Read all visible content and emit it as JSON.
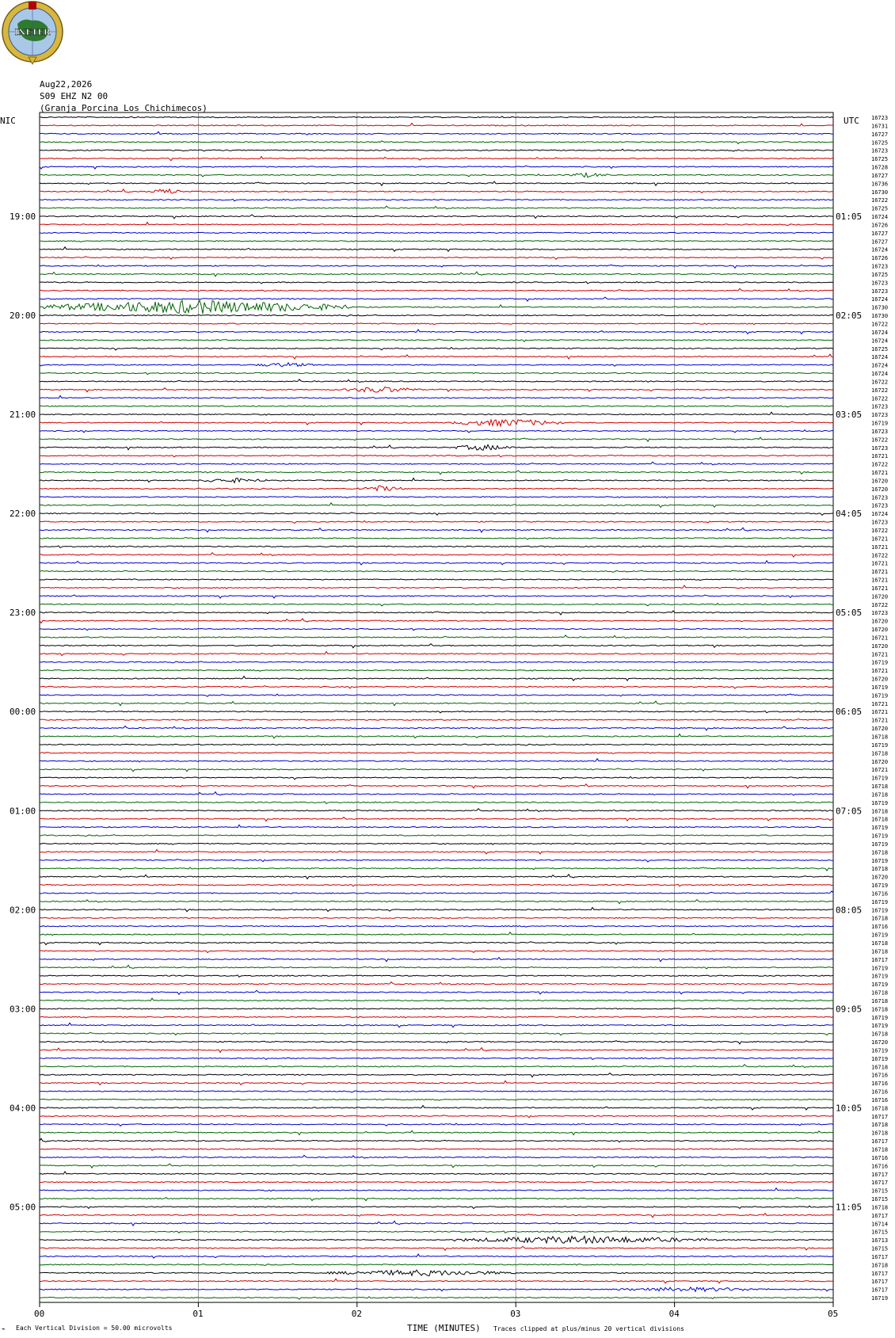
{
  "header": {
    "org": "INETER",
    "date": "Aug22,2026",
    "channel": "S09 EHZ N2 00",
    "station": "(Granja Porcina Los Chichimecos)"
  },
  "labels": {
    "left_tz": "NIC",
    "right_tz": "UTC",
    "xlabel": "TIME (MINUTES)",
    "scale_note": "Each Vertical Division =    50.00 microvolts",
    "clip_note": "Traces clipped at plus/minus 20 vertical divisions"
  },
  "colors": {
    "trace_cycle": [
      "#000000",
      "#d00000",
      "#0000d0",
      "#006400"
    ],
    "grid": "#888888"
  },
  "chart_data": {
    "type": "line",
    "title": "",
    "xlabel": "TIME (MINUTES)",
    "ylabel": "",
    "xlim": [
      0,
      5
    ],
    "x_ticks": [
      "00",
      "01",
      "02",
      "03",
      "04",
      "05"
    ],
    "rows": 144,
    "left_hour_labels": [
      {
        "row": 12,
        "label": "19:00"
      },
      {
        "row": 24,
        "label": "20:00"
      },
      {
        "row": 36,
        "label": "21:00"
      },
      {
        "row": 48,
        "label": "22:00"
      },
      {
        "row": 60,
        "label": "23:00"
      },
      {
        "row": 72,
        "label": "00:00"
      },
      {
        "row": 84,
        "label": "01:00"
      },
      {
        "row": 96,
        "label": "02:00"
      },
      {
        "row": 108,
        "label": "03:00"
      },
      {
        "row": 120,
        "label": "04:00"
      },
      {
        "row": 132,
        "label": "05:00"
      }
    ],
    "right_hour_labels": [
      {
        "row": 12,
        "label": "01:05"
      },
      {
        "row": 24,
        "label": "02:05"
      },
      {
        "row": 36,
        "label": "03:05"
      },
      {
        "row": 48,
        "label": "04:05"
      },
      {
        "row": 60,
        "label": "05:05"
      },
      {
        "row": 72,
        "label": "06:05"
      },
      {
        "row": 84,
        "label": "07:05"
      },
      {
        "row": 96,
        "label": "08:05"
      },
      {
        "row": 108,
        "label": "09:05"
      },
      {
        "row": 120,
        "label": "10:05"
      },
      {
        "row": 132,
        "label": "11:05"
      }
    ],
    "row_counts": [
      16723,
      16731,
      16727,
      16725,
      16723,
      16725,
      16728,
      16727,
      16736,
      16730,
      16722,
      16725,
      16724,
      16726,
      16727,
      16727,
      16724,
      16726,
      16723,
      16725,
      16723,
      16723,
      16724,
      16730,
      16730,
      16722,
      16724,
      16724,
      16725,
      16724,
      16724,
      16724,
      16722,
      16722,
      16722,
      16723,
      16723,
      16719,
      16723,
      16722,
      16723,
      16721,
      16722,
      16721,
      16720,
      16720,
      16723,
      16723,
      16724,
      16723,
      16722,
      16721,
      16721,
      16722,
      16721,
      16721,
      16721,
      16721,
      16720,
      16722,
      16723,
      16720,
      16720,
      16721,
      16720,
      16721,
      16719,
      16721,
      16720,
      16719,
      16719,
      16721,
      16721,
      16721,
      16720,
      16718,
      16719,
      16718,
      16720,
      16721,
      16719,
      16718,
      16718,
      16719,
      16718,
      16718,
      16719,
      16719,
      16719,
      16718,
      16719,
      16718,
      16720,
      16719,
      16716,
      16719,
      16719,
      16718,
      16716,
      16719,
      16718,
      16718,
      16717,
      16719,
      16719,
      16719,
      16718,
      16718,
      16718,
      16719,
      16719,
      16718,
      16720,
      16719,
      16719,
      16718,
      16716,
      16716,
      16716,
      16716,
      16718,
      16717,
      16718,
      16718,
      16717,
      16718,
      16716,
      16716,
      16717,
      16717,
      16715,
      16715,
      16718,
      16717,
      16714,
      16715,
      16713,
      16715,
      16717,
      16718,
      16717,
      16717,
      16717,
      16719
    ],
    "events": [
      {
        "row": 7,
        "start": 3.3,
        "end": 3.6,
        "amp": 3
      },
      {
        "row": 9,
        "start": 0.7,
        "end": 0.9,
        "amp": 4
      },
      {
        "row": 23,
        "start": 0.0,
        "end": 1.95,
        "amp": 9
      },
      {
        "row": 30,
        "start": 1.35,
        "end": 1.75,
        "amp": 3
      },
      {
        "row": 33,
        "start": 1.9,
        "end": 2.4,
        "amp": 4
      },
      {
        "row": 37,
        "start": 2.6,
        "end": 3.3,
        "amp": 5
      },
      {
        "row": 40,
        "start": 2.6,
        "end": 3.0,
        "amp": 4
      },
      {
        "row": 44,
        "start": 1.0,
        "end": 1.45,
        "amp": 3
      },
      {
        "row": 45,
        "start": 2.0,
        "end": 2.3,
        "amp": 4
      },
      {
        "row": 136,
        "start": 2.6,
        "end": 4.2,
        "amp": 5
      },
      {
        "row": 140,
        "start": 1.8,
        "end": 3.0,
        "amp": 4
      },
      {
        "row": 142,
        "start": 3.6,
        "end": 4.6,
        "amp": 3
      }
    ]
  }
}
